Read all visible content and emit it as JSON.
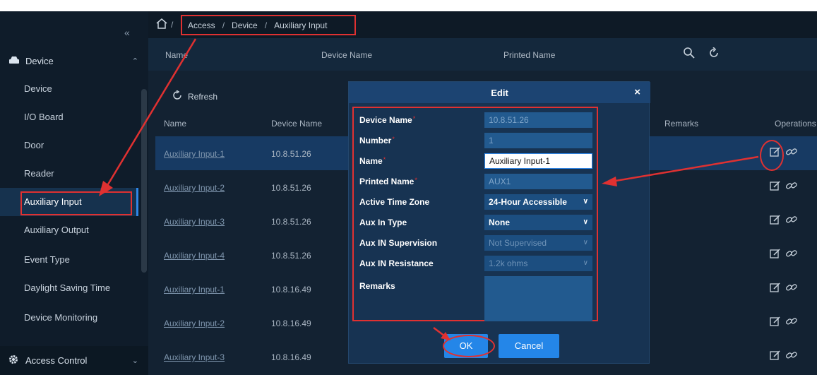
{
  "sidebar": {
    "collapse_glyph": "«",
    "group_device": "Device",
    "items": [
      {
        "label": "Device"
      },
      {
        "label": "I/O Board"
      },
      {
        "label": "Door"
      },
      {
        "label": "Reader"
      },
      {
        "label": "Auxiliary Input",
        "active": true
      },
      {
        "label": "Auxiliary Output"
      },
      {
        "label": "Event Type"
      },
      {
        "label": "Daylight Saving Time"
      },
      {
        "label": "Device Monitoring"
      }
    ],
    "group_access": "Access Control"
  },
  "breadcrumb": {
    "items": [
      "Access",
      "Device",
      "Auxiliary Input"
    ],
    "separator": "/"
  },
  "search": {
    "fields": [
      "Name",
      "Device Name",
      "Printed Name"
    ]
  },
  "toolbar": {
    "refresh_label": "Refresh"
  },
  "table": {
    "headers": [
      "Name",
      "Device Name",
      "Remarks",
      "Operations"
    ],
    "rows": [
      {
        "name": "Auxiliary Input-1",
        "device": "10.8.51.26",
        "selected": true
      },
      {
        "name": "Auxiliary Input-2",
        "device": "10.8.51.26"
      },
      {
        "name": "Auxiliary Input-3",
        "device": "10.8.51.26"
      },
      {
        "name": "Auxiliary Input-4",
        "device": "10.8.51.26"
      },
      {
        "name": "Auxiliary Input-1",
        "device": "10.8.16.49"
      },
      {
        "name": "Auxiliary Input-2",
        "device": "10.8.16.49"
      },
      {
        "name": "Auxiliary Input-3",
        "device": "10.8.16.49"
      }
    ]
  },
  "modal": {
    "title": "Edit",
    "close_glyph": "×",
    "fields": {
      "device_name": {
        "label": "Device Name",
        "value": "10.8.51.26"
      },
      "number": {
        "label": "Number",
        "value": "1"
      },
      "name": {
        "label": "Name",
        "value": "Auxiliary Input-1"
      },
      "printed_name": {
        "label": "Printed Name",
        "value": "AUX1"
      },
      "active_time_zone": {
        "label": "Active Time Zone",
        "value": "24-Hour Accessible"
      },
      "aux_in_type": {
        "label": "Aux In Type",
        "value": "None"
      },
      "aux_in_supervision": {
        "label": "Aux IN Supervision",
        "value": "Not Supervised"
      },
      "aux_in_resistance": {
        "label": "Aux IN Resistance",
        "value": "1.2k ohms"
      },
      "remarks": {
        "label": "Remarks",
        "value": ""
      }
    },
    "ok_label": "OK",
    "cancel_label": "Cancel"
  },
  "colors": {
    "accent": "#2486e8",
    "annotation": "#e03131",
    "selected_row": "#173a63"
  }
}
